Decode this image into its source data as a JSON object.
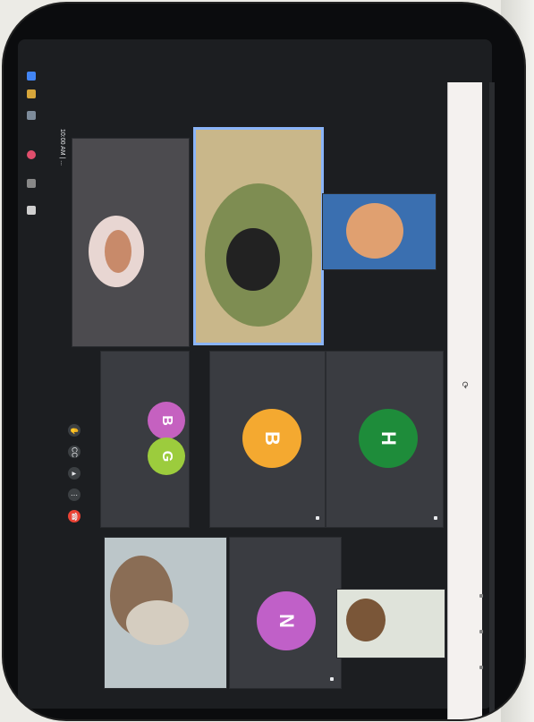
{
  "meeting": {
    "time_label": "10:00 AM | ..."
  },
  "tiles": [
    {
      "id": "t1",
      "label": "",
      "kind": "video"
    },
    {
      "id": "t2",
      "label": "",
      "kind": "video",
      "active": true
    },
    {
      "id": "t3",
      "label": "",
      "kind": "video"
    },
    {
      "id": "t4",
      "label": "",
      "kind": "avatars",
      "avatars": [
        {
          "letter": "B",
          "color": "#c561c0"
        },
        {
          "letter": "G",
          "color": "#9ccc3d"
        }
      ]
    },
    {
      "id": "t5",
      "label": "",
      "kind": "avatar",
      "letter": "B",
      "color": "#f4a930"
    },
    {
      "id": "t6",
      "label": "",
      "kind": "avatar",
      "letter": "H",
      "color": "#1e8c3a"
    },
    {
      "id": "t7",
      "label": "",
      "kind": "video"
    },
    {
      "id": "t8",
      "label": "",
      "kind": "avatar",
      "letter": "N",
      "color": "#c060c8"
    },
    {
      "id": "t9",
      "label": "",
      "kind": "video"
    }
  ],
  "controls": [
    {
      "name": "raise-hand-button",
      "glyph": "✋"
    },
    {
      "name": "captions-button",
      "glyph": "CC"
    },
    {
      "name": "present-button",
      "glyph": "▲"
    },
    {
      "name": "more-options-button",
      "glyph": "⋮"
    },
    {
      "name": "leave-call-button",
      "glyph": "☎",
      "red": true
    }
  ],
  "browser": {
    "url": ""
  },
  "colors": {
    "background": "#1c1e21",
    "tile": "#3a3c41",
    "accent": "#8ab4f8",
    "end_call": "#ea4335"
  }
}
